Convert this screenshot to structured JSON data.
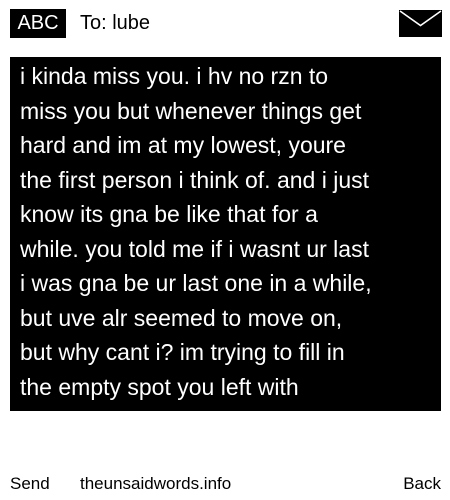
{
  "header": {
    "mode_badge": "ABC",
    "recipient": "To: lube",
    "envelope_icon": "envelope-icon"
  },
  "message": {
    "text": "i kinda miss you. i hv no rzn to\nmiss you but whenever things get\nhard and im at my lowest, youre\nthe first person i think of. and i just\nknow its gna be like that for a\nwhile. you told me if i wasnt ur last\ni was gna be ur last one in a while,\nbut uve alr seemed to move on,\nbut why cant i? im trying to fill in\nthe empty spot you left with"
  },
  "footer": {
    "send_label": "Send",
    "site_label": "theunsaidwords.info",
    "back_label": "Back"
  },
  "colors": {
    "background": "#ffffff",
    "message_background": "#000000",
    "message_text": "#ffffff",
    "text": "#000000"
  }
}
